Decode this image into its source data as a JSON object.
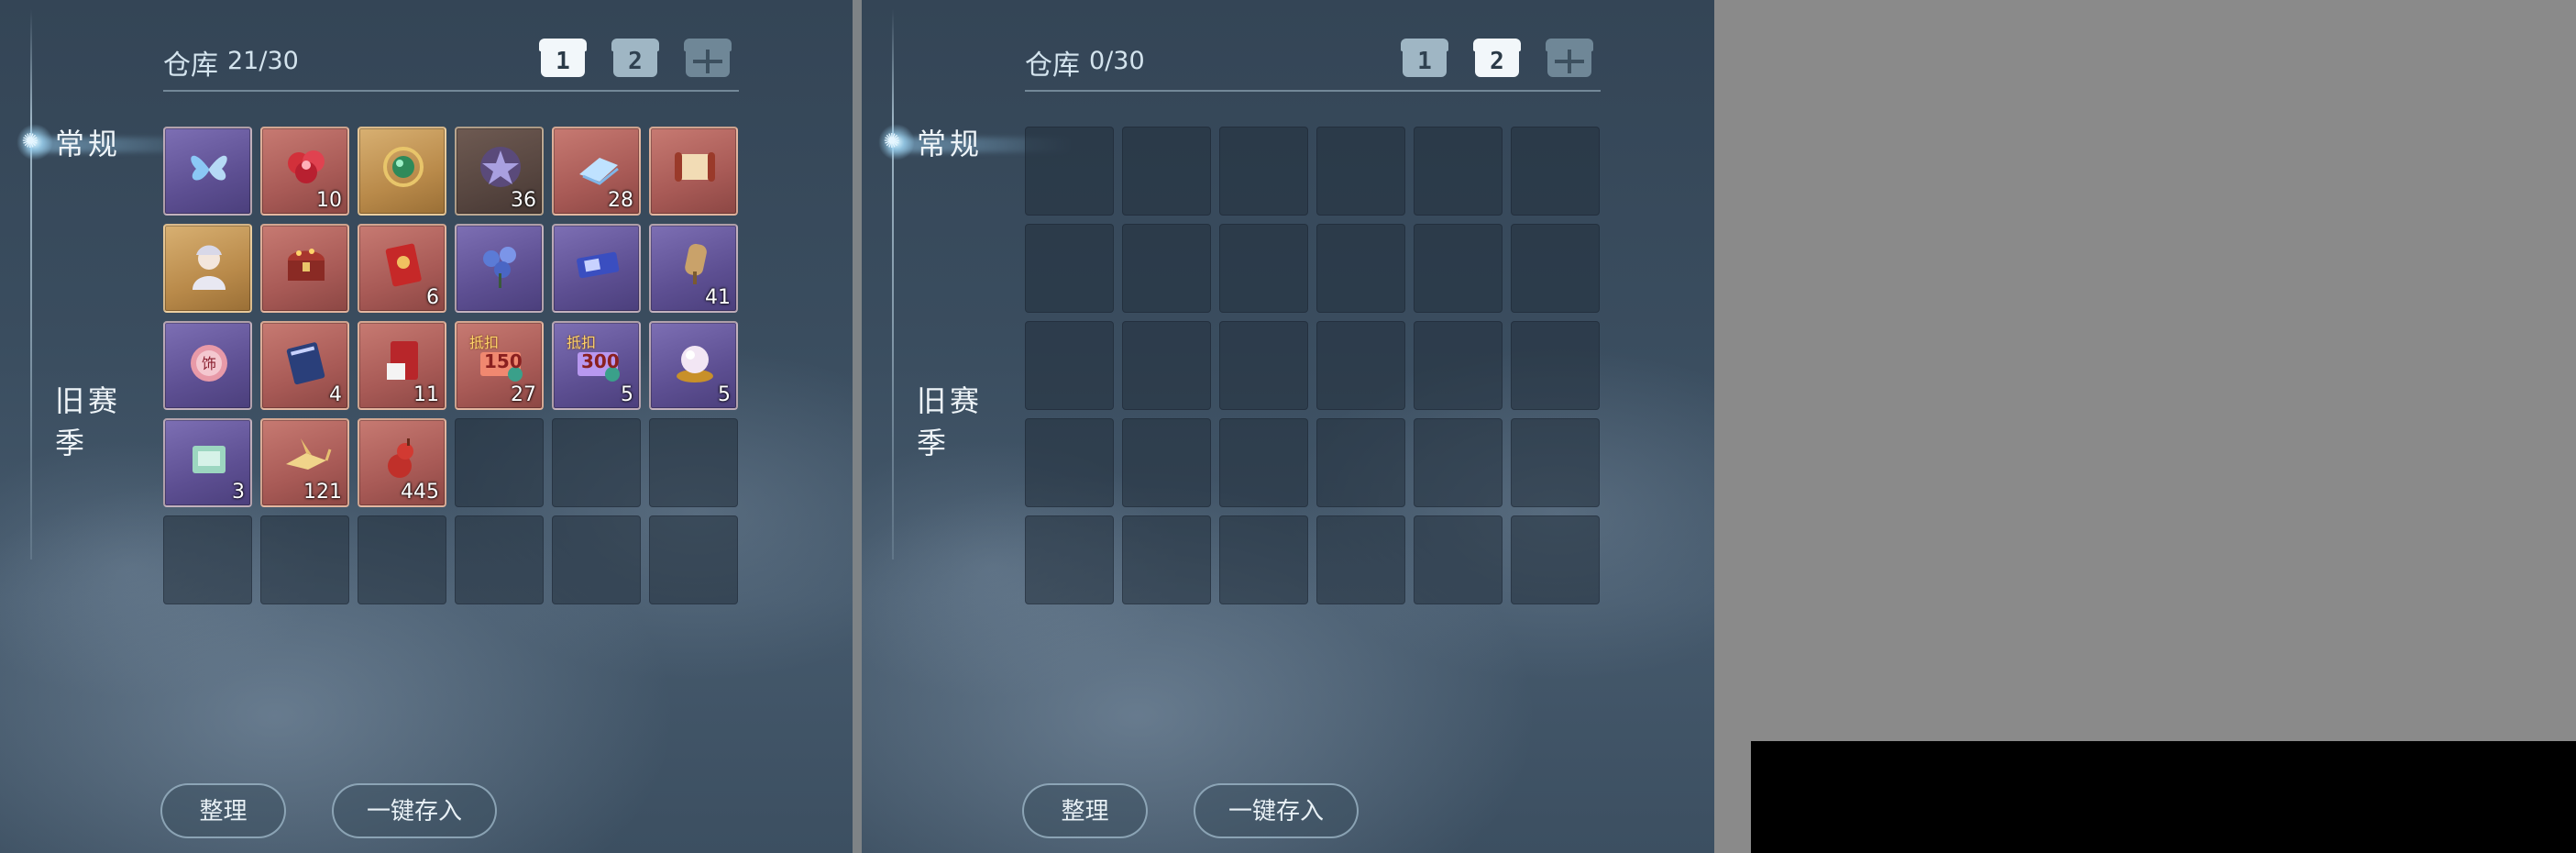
{
  "left_panel": {
    "tabs": {
      "normal": "常规",
      "old_season": "旧赛季"
    },
    "title": {
      "label": "仓库",
      "count": "21/30"
    },
    "chest_tabs": [
      {
        "num": "1",
        "state": "active"
      },
      {
        "num": "2",
        "state": "idle"
      },
      {
        "num": "",
        "state": "locked"
      }
    ],
    "items": [
      {
        "name": "butterfly",
        "quality": "purple",
        "qty": ""
      },
      {
        "name": "red-flower-bundle",
        "quality": "red",
        "qty": "10"
      },
      {
        "name": "jade-gem",
        "quality": "gold",
        "qty": ""
      },
      {
        "name": "star-medallion",
        "quality": "dark",
        "qty": "36"
      },
      {
        "name": "blue-cloth",
        "quality": "red",
        "qty": "28"
      },
      {
        "name": "scroll",
        "quality": "red",
        "qty": ""
      },
      {
        "name": "character-portrait",
        "quality": "gold",
        "qty": ""
      },
      {
        "name": "treasure-chest",
        "quality": "red",
        "qty": ""
      },
      {
        "name": "red-envelope",
        "quality": "red",
        "qty": "6"
      },
      {
        "name": "blue-flowers",
        "quality": "purple",
        "qty": ""
      },
      {
        "name": "ticket",
        "quality": "purple",
        "qty": ""
      },
      {
        "name": "token-tag",
        "quality": "purple",
        "qty": "41"
      },
      {
        "name": "ornament-pouch",
        "quality": "purple",
        "qty": "",
        "badge": "饰"
      },
      {
        "name": "book",
        "quality": "red",
        "qty": "4"
      },
      {
        "name": "red-booklet",
        "quality": "red",
        "qty": "11"
      },
      {
        "name": "voucher-150",
        "quality": "red",
        "qty": "27",
        "tag": "抵扣",
        "value": "150"
      },
      {
        "name": "voucher-300",
        "quality": "purple",
        "qty": "5",
        "tag": "抵扣",
        "value": "300"
      },
      {
        "name": "crystal-ball",
        "quality": "purple",
        "qty": "5"
      },
      {
        "name": "jade-box",
        "quality": "purple",
        "qty": "3"
      },
      {
        "name": "paper-crane",
        "quality": "red",
        "qty": "121"
      },
      {
        "name": "red-gourd",
        "quality": "red",
        "qty": "445"
      }
    ],
    "buttons": {
      "sort": "整理",
      "deposit_all": "一键存入"
    }
  },
  "right_panel": {
    "tabs": {
      "normal": "常规",
      "old_season": "旧赛季"
    },
    "title": {
      "label": "仓库",
      "count": "0/30"
    },
    "chest_tabs": [
      {
        "num": "1",
        "state": "idle"
      },
      {
        "num": "2",
        "state": "active"
      },
      {
        "num": "",
        "state": "locked"
      }
    ],
    "buttons": {
      "sort": "整理",
      "deposit_all": "一键存入"
    }
  },
  "colors": {
    "accent": "#d4e4ee",
    "panel_bg": "#3a4d5f",
    "gray_bg": "#8a8a8a"
  }
}
